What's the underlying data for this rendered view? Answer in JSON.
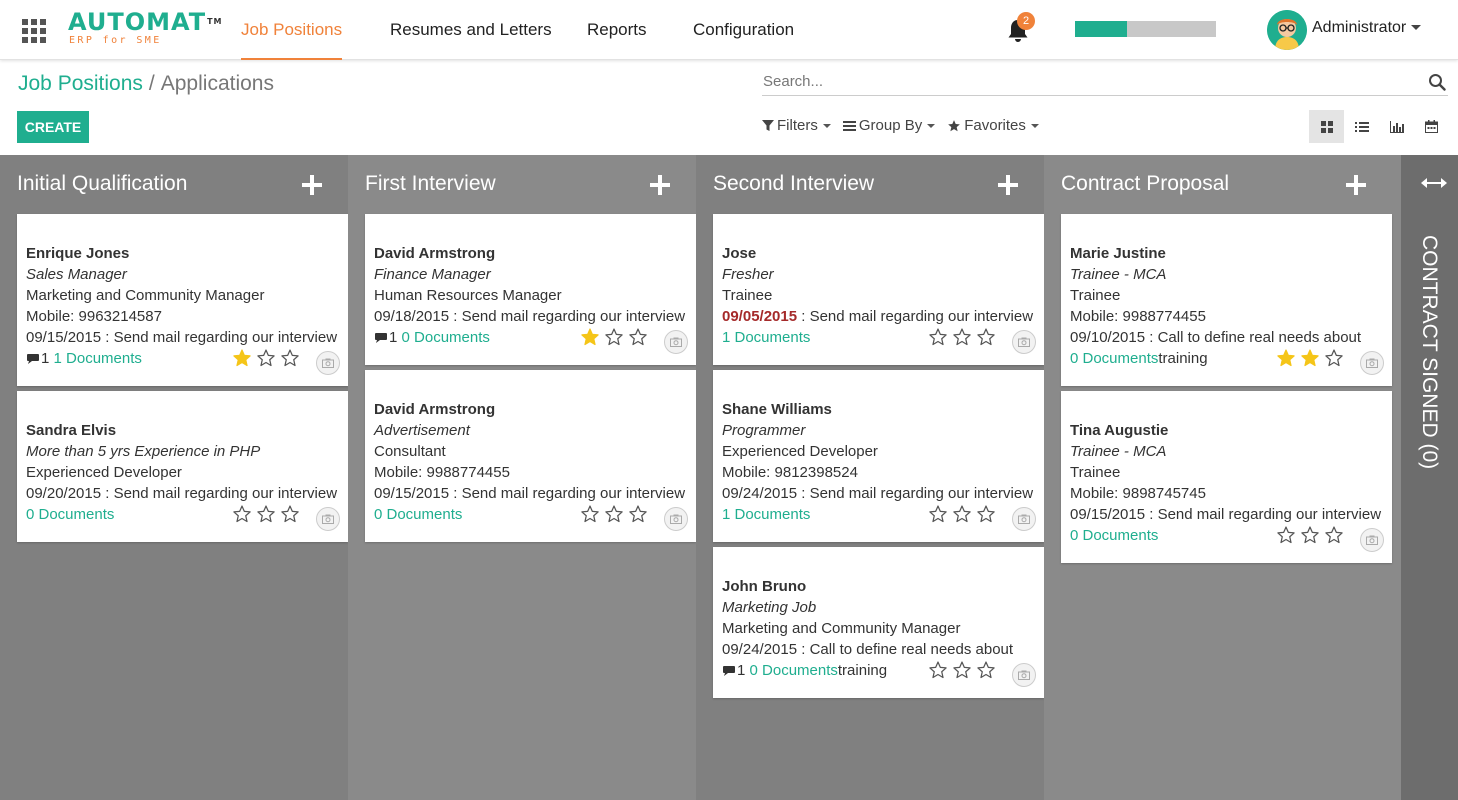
{
  "brand": {
    "name": "AUTOMAT",
    "trademark": "TM",
    "tagline": "ERP for SME"
  },
  "nav": [
    {
      "label": "Job Positions",
      "active": true
    },
    {
      "label": "Resumes and Letters",
      "active": false
    },
    {
      "label": "Reports",
      "active": false
    },
    {
      "label": "Configuration",
      "active": false
    }
  ],
  "topbar": {
    "notification_count": "2",
    "progress_fraction": 0.37,
    "user_name": "Administrator"
  },
  "breadcrumb": {
    "parent": "Job Positions",
    "separator": "/",
    "current": "Applications"
  },
  "actions": {
    "create_label": "CREATE"
  },
  "search": {
    "placeholder": "Search..."
  },
  "filters": {
    "filters_label": "Filters",
    "groupby_label": "Group By",
    "favorites_label": "Favorites"
  },
  "views": [
    "kanban-view-icon",
    "list-view-icon",
    "graph-view-icon",
    "calendar-view-icon"
  ],
  "colors": {
    "accent": "#1fae8f",
    "orange": "#f0823a",
    "overdue": "#a52a2a",
    "star": "#f5c518"
  },
  "columns": [
    {
      "title": "Initial Qualification",
      "cards": [
        {
          "name": "Enrique Jones",
          "job": "Sales Manager",
          "department": "Marketing and Community Manager",
          "mobile": "Mobile: 9963214587",
          "activity_date": "09/15/2015",
          "activity_text": " : Send mail regarding our interview",
          "messages": "1",
          "documents": "1 Documents",
          "suffix": "",
          "stars": 1
        },
        {
          "name": "Sandra Elvis",
          "job": "More than 5 yrs Experience in PHP",
          "department": "Experienced Developer",
          "mobile": "",
          "activity_date": "09/20/2015",
          "activity_text": " : Send mail regarding our interview",
          "messages": "",
          "documents": "0 Documents",
          "suffix": "",
          "stars": 0
        }
      ]
    },
    {
      "title": "First Interview",
      "cards": [
        {
          "name": "David Armstrong",
          "job": "Finance Manager",
          "department": "Human Resources Manager",
          "mobile": "",
          "activity_date": "09/18/2015",
          "activity_text": " : Send mail regarding our interview",
          "messages": "1",
          "documents": "0 Documents",
          "suffix": "",
          "stars": 1
        },
        {
          "name": "David Armstrong",
          "job": "Advertisement",
          "department": "Consultant",
          "mobile": "Mobile: 9988774455",
          "activity_date": "09/15/2015",
          "activity_text": " : Send mail regarding our interview",
          "messages": "",
          "documents": "0 Documents",
          "suffix": "",
          "stars": 0
        }
      ]
    },
    {
      "title": "Second Interview",
      "cards": [
        {
          "name": "Jose",
          "job": "Fresher",
          "department": "Trainee",
          "mobile": "",
          "activity_date": "09/05/2015",
          "activity_text": " : Send mail regarding our interview",
          "overdue": true,
          "messages": "",
          "documents": "1 Documents",
          "suffix": "",
          "stars": 0
        },
        {
          "name": "Shane Williams",
          "job": "Programmer",
          "department": "Experienced Developer",
          "mobile": "Mobile: 9812398524",
          "activity_date": "09/24/2015",
          "activity_text": " : Send mail regarding our interview",
          "messages": "",
          "documents": "1 Documents",
          "suffix": "",
          "stars": 0
        },
        {
          "name": "John Bruno",
          "job": "Marketing Job",
          "department": "Marketing and Community Manager",
          "mobile": "",
          "activity_date": "09/24/2015",
          "activity_text": " : Call to define real needs about",
          "messages": "1",
          "documents": "0 Documents",
          "suffix": "training",
          "stars": 0
        }
      ]
    },
    {
      "title": "Contract Proposal",
      "cards": [
        {
          "name": "Marie Justine",
          "job": "Trainee - MCA",
          "department": "Trainee",
          "mobile": "Mobile: 9988774455",
          "activity_date": "09/10/2015",
          "activity_text": " : Call to define real needs about",
          "messages": "",
          "documents": "0 Documents",
          "suffix": "training",
          "stars": 2
        },
        {
          "name": "Tina Augustie",
          "job": "Trainee - MCA",
          "department": "Trainee",
          "mobile": "Mobile: 9898745745",
          "activity_date": "09/15/2015",
          "activity_text": " : Send mail regarding our interview",
          "messages": "",
          "documents": "0 Documents",
          "suffix": "",
          "stars": 0
        }
      ]
    }
  ],
  "folded_column": {
    "title": "CONTRACT SIGNED (0)"
  }
}
